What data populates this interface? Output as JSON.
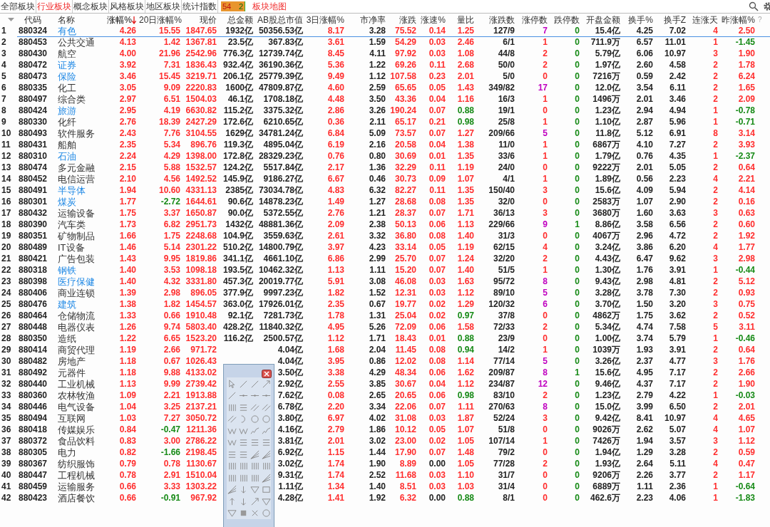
{
  "tabs": [
    {
      "label": "全部板块",
      "selected": false
    },
    {
      "label": "行业板块",
      "selected": true
    },
    {
      "label": "概念板块",
      "selected": false
    },
    {
      "label": "风格板块",
      "selected": false
    },
    {
      "label": "地区板块",
      "selected": false
    },
    {
      "label": "统计指数",
      "selected": false
    }
  ],
  "breadth": {
    "up": "54",
    "down": "2",
    "level": 0.96
  },
  "map_link": "板块地图",
  "header": {
    "help": "?",
    "columns": [
      {
        "label": "代码",
        "kind": "plain",
        "sorted": false
      },
      {
        "label": "名称",
        "kind": "plain",
        "sorted": false
      },
      {
        "label": "涨幅%",
        "kind": "gain",
        "sorted": true
      },
      {
        "label": "20日涨幅%",
        "kind": "gain",
        "sorted": false
      },
      {
        "label": "现价",
        "kind": "gain",
        "sorted": false
      },
      {
        "label": "总金额",
        "kind": "plain",
        "sorted": false
      },
      {
        "label": "AB股总市值",
        "kind": "plain",
        "sorted": false
      },
      {
        "label": "3日涨幅%",
        "kind": "gain",
        "sorted": false
      },
      {
        "label": "市净率",
        "kind": "plain",
        "sorted": false
      },
      {
        "label": "涨跌",
        "kind": "gain",
        "sorted": false
      },
      {
        "label": "涨速%",
        "kind": "gain",
        "sorted": false
      },
      {
        "label": "量比",
        "kind": "gain",
        "sorted": false
      },
      {
        "label": "涨跌数",
        "kind": "plain",
        "sorted": false
      },
      {
        "label": "涨停数",
        "kind": "gain",
        "sorted": false
      },
      {
        "label": "跌停数",
        "kind": "loss",
        "sorted": false
      },
      {
        "label": "开盘金额",
        "kind": "plain",
        "sorted": false
      },
      {
        "label": "换手%",
        "kind": "plain",
        "sorted": false
      },
      {
        "label": "换手Z",
        "kind": "plain",
        "sorted": false
      },
      {
        "label": "连涨天",
        "kind": "gain",
        "sorted": false
      },
      {
        "label": "昨涨幅%",
        "kind": "gain",
        "sorted": false
      }
    ]
  },
  "rows": [
    {
      "no": "1",
      "code": "880324",
      "name": "有色",
      "marked": true,
      "selected": true,
      "under_toolbar": false,
      "cells": [
        "4.26",
        "15.55",
        "1847.65",
        "1932亿",
        "50356.53亿",
        "8.17",
        "3.28",
        "75.52",
        "0.14",
        "1.25",
        "127/9",
        {
          "text": "7",
          "kind": "hot"
        },
        "0",
        "15.4亿",
        "4.25",
        "7.02",
        "4",
        "2.50"
      ]
    },
    {
      "no": "2",
      "code": "880453",
      "name": "公共交通",
      "marked": false,
      "selected": false,
      "under_toolbar": false,
      "cells": [
        "4.13",
        "1.42",
        "1367.81",
        "23.5亿",
        "367.83亿",
        "3.61",
        "1.59",
        "54.29",
        "0.03",
        "2.46",
        "6/1",
        "1",
        "0",
        "711.9万",
        "6.57",
        "11.01",
        "1",
        {
          "text": "-1.45",
          "kind": "loss"
        }
      ]
    },
    {
      "no": "3",
      "code": "880430",
      "name": "航空",
      "marked": false,
      "selected": false,
      "under_toolbar": false,
      "cells": [
        "4.00",
        "21.96",
        "2542.96",
        "776.3亿",
        "12739.74亿",
        "8.45",
        "4.11",
        "97.92",
        "0.03",
        "1.08",
        "44/8",
        "2",
        "0",
        "5.79亿",
        "6.06",
        "10.97",
        "3",
        "1.90"
      ]
    },
    {
      "no": "4",
      "code": "880472",
      "name": "证券",
      "marked": true,
      "selected": false,
      "under_toolbar": false,
      "cells": [
        "3.92",
        "7.31",
        "1836.43",
        "932.4亿",
        "36190.36亿",
        "5.36",
        "1.22",
        "69.26",
        "0.11",
        "2.68",
        "50/0",
        "2",
        "0",
        "1.97亿",
        "2.60",
        "4.58",
        "2",
        "1.78"
      ]
    },
    {
      "no": "5",
      "code": "880473",
      "name": "保险",
      "marked": true,
      "selected": false,
      "under_toolbar": false,
      "cells": [
        "3.46",
        "15.45",
        "3219.71",
        "206.1亿",
        "25779.39亿",
        "9.49",
        "1.12",
        "107.58",
        "0.23",
        "2.01",
        "5/0",
        "0",
        "0",
        "7216万",
        "0.59",
        "2.42",
        "2",
        "6.24"
      ]
    },
    {
      "no": "6",
      "code": "880335",
      "name": "化工",
      "marked": false,
      "selected": false,
      "under_toolbar": false,
      "cells": [
        "3.05",
        "9.09",
        "2220.83",
        "1600亿",
        "47809.87亿",
        "4.60",
        "2.59",
        "65.65",
        "0.05",
        "1.43",
        "349/82",
        {
          "text": "17",
          "kind": "hot"
        },
        "0",
        "12.0亿",
        "3.54",
        "6.11",
        "2",
        "1.65"
      ]
    },
    {
      "no": "7",
      "code": "880497",
      "name": "综合类",
      "marked": false,
      "selected": false,
      "under_toolbar": false,
      "cells": [
        "2.97",
        "6.51",
        "1504.03",
        "46.1亿",
        "1708.18亿",
        "4.48",
        "3.50",
        "43.36",
        "0.04",
        "1.16",
        "16/3",
        "1",
        "0",
        "1496万",
        "2.01",
        "3.46",
        "2",
        "2.09"
      ]
    },
    {
      "no": "8",
      "code": "880424",
      "name": "旅游",
      "marked": true,
      "selected": false,
      "under_toolbar": false,
      "cells": [
        "2.95",
        "4.19",
        "6630.82",
        "115.2亿",
        "3375.32亿",
        "2.86",
        "3.26",
        "190.24",
        "0.07",
        {
          "text": "0.88",
          "kind": "loss"
        },
        "19/1",
        "0",
        "0",
        "1.23亿",
        "2.94",
        "4.94",
        "1",
        {
          "text": "-0.78",
          "kind": "loss"
        }
      ]
    },
    {
      "no": "9",
      "code": "880330",
      "name": "化纤",
      "marked": false,
      "selected": false,
      "under_toolbar": false,
      "cells": [
        "2.76",
        "18.39",
        "2427.29",
        "172.6亿",
        "6210.65亿",
        "0.36",
        "2.11",
        "65.17",
        "0.21",
        {
          "text": "0.98",
          "kind": "loss"
        },
        "25/8",
        "1",
        "0",
        "1.10亿",
        "2.87",
        "5.96",
        "1",
        {
          "text": "-0.71",
          "kind": "loss"
        }
      ]
    },
    {
      "no": "10",
      "code": "880493",
      "name": "软件服务",
      "marked": false,
      "selected": false,
      "under_toolbar": false,
      "cells": [
        "2.43",
        "7.76",
        "3104.55",
        "1629亿",
        "34781.24亿",
        "6.84",
        "5.09",
        "73.57",
        "0.07",
        "1.27",
        "209/66",
        {
          "text": "5",
          "kind": "hot"
        },
        "0",
        "11.8亿",
        "5.12",
        "6.91",
        "8",
        "3.14"
      ]
    },
    {
      "no": "11",
      "code": "880431",
      "name": "船舶",
      "marked": false,
      "selected": false,
      "under_toolbar": false,
      "cells": [
        "2.35",
        "5.34",
        "896.76",
        "119.3亿",
        "4895.04亿",
        "6.19",
        "2.16",
        "20.58",
        "0.04",
        "1.38",
        "11/0",
        "1",
        "0",
        "6867万",
        "4.10",
        "7.27",
        "2",
        "3.93"
      ]
    },
    {
      "no": "12",
      "code": "880310",
      "name": "石油",
      "marked": true,
      "selected": false,
      "under_toolbar": false,
      "cells": [
        "2.24",
        "4.29",
        "1398.00",
        "172.8亿",
        "28329.23亿",
        "0.76",
        "0.80",
        "30.69",
        "0.01",
        "1.35",
        "33/6",
        "1",
        "0",
        "1.79亿",
        "0.76",
        "4.35",
        "1",
        {
          "text": "-2.37",
          "kind": "loss"
        }
      ]
    },
    {
      "no": "13",
      "code": "880474",
      "name": "多元金融",
      "marked": false,
      "selected": false,
      "under_toolbar": false,
      "cells": [
        "2.15",
        "5.88",
        "1532.57",
        "124.2亿",
        "5517.84亿",
        "2.17",
        "1.36",
        "32.29",
        "0.11",
        "1.19",
        "24/0",
        "0",
        "0",
        "9222万",
        "2.01",
        "5.05",
        "2",
        "0.64"
      ]
    },
    {
      "no": "14",
      "code": "880452",
      "name": "电信运营",
      "marked": false,
      "selected": false,
      "under_toolbar": false,
      "cells": [
        "2.10",
        "4.56",
        "1492.52",
        "145.9亿",
        "9186.27亿",
        "6.67",
        "0.46",
        "30.73",
        "0.09",
        "1.07",
        "4/1",
        "1",
        "0",
        "1.89亿",
        "0.56",
        "2.23",
        "4",
        "2.21"
      ]
    },
    {
      "no": "15",
      "code": "880491",
      "name": "半导体",
      "marked": true,
      "selected": false,
      "under_toolbar": false,
      "cells": [
        "1.94",
        "10.60",
        "4331.13",
        "2385亿",
        "73034.78亿",
        "4.83",
        "6.32",
        "82.27",
        "0.11",
        "1.35",
        "150/40",
        "3",
        "0",
        "15.6亿",
        "4.09",
        "5.94",
        "2",
        "4.14"
      ]
    },
    {
      "no": "16",
      "code": "880301",
      "name": "煤炭",
      "marked": true,
      "selected": false,
      "under_toolbar": false,
      "cells": [
        "1.77",
        {
          "text": "-2.72",
          "kind": "loss"
        },
        "1644.61",
        "90.6亿",
        "14878.23亿",
        "1.49",
        "1.27",
        "28.68",
        "0.08",
        "1.35",
        "32/0",
        "0",
        "0",
        "2583万",
        "1.07",
        "2.90",
        "2",
        "0.16"
      ]
    },
    {
      "no": "17",
      "code": "880432",
      "name": "运输设备",
      "marked": false,
      "selected": false,
      "under_toolbar": false,
      "cells": [
        "1.75",
        "3.37",
        "1650.87",
        "90.0亿",
        "5372.55亿",
        "2.76",
        "1.21",
        "28.37",
        "0.07",
        "1.71",
        "36/13",
        "3",
        "0",
        "3680万",
        "1.60",
        "3.63",
        "3",
        "0.63"
      ]
    },
    {
      "no": "18",
      "code": "880390",
      "name": "汽车类",
      "marked": false,
      "selected": false,
      "under_toolbar": false,
      "cells": [
        "1.73",
        "6.82",
        "2951.73",
        "1432亿",
        "48881.36亿",
        "2.09",
        "2.38",
        "50.13",
        "0.06",
        "1.13",
        "229/66",
        {
          "text": "9",
          "kind": "hot"
        },
        "1",
        "8.86亿",
        "3.58",
        "6.56",
        "2",
        "0.60"
      ]
    },
    {
      "no": "19",
      "code": "880351",
      "name": "矿物制品",
      "marked": false,
      "selected": false,
      "under_toolbar": false,
      "cells": [
        "1.66",
        "1.75",
        "2248.68",
        "104.9亿",
        "3559.63亿",
        "2.61",
        "3.32",
        "36.80",
        "0.08",
        "1.40",
        "31/3",
        "0",
        "0",
        "4067万",
        "2.96",
        "4.72",
        "2",
        "1.92"
      ]
    },
    {
      "no": "20",
      "code": "880489",
      "name": "IT设备",
      "marked": false,
      "selected": false,
      "under_toolbar": false,
      "cells": [
        "1.46",
        "5.14",
        "2301.22",
        "510.2亿",
        "14800.79亿",
        "3.97",
        "4.23",
        "33.14",
        "0.05",
        "1.19",
        "62/15",
        "4",
        "0",
        "3.24亿",
        "3.86",
        "6.20",
        "4",
        "1.77"
      ]
    },
    {
      "no": "21",
      "code": "880421",
      "name": "广告包装",
      "marked": false,
      "selected": false,
      "under_toolbar": false,
      "cells": [
        "1.43",
        "9.95",
        "1819.86",
        "341.1亿",
        "4661.10亿",
        "6.86",
        "2.99",
        "25.70",
        "0.07",
        "1.24",
        "32/20",
        "2",
        "0",
        "4.43亿",
        "6.47",
        "9.62",
        "3",
        "2.98"
      ]
    },
    {
      "no": "22",
      "code": "880318",
      "name": "钢铁",
      "marked": true,
      "selected": false,
      "under_toolbar": false,
      "cells": [
        "1.40",
        "3.53",
        "1098.18",
        "193.5亿",
        "10462.32亿",
        "1.13",
        "1.11",
        "15.20",
        "0.07",
        "1.40",
        "51/5",
        "1",
        "0",
        "1.30亿",
        "1.76",
        "3.91",
        "1",
        {
          "text": "-0.44",
          "kind": "loss"
        }
      ]
    },
    {
      "no": "23",
      "code": "880398",
      "name": "医疗保健",
      "marked": true,
      "selected": false,
      "under_toolbar": false,
      "cells": [
        "1.40",
        "4.32",
        "3331.80",
        "457.3亿",
        "20019.77亿",
        "5.91",
        "3.08",
        "46.08",
        "0.03",
        "1.63",
        "95/72",
        {
          "text": "8",
          "kind": "hot"
        },
        "0",
        "9.43亿",
        "2.98",
        "4.81",
        "2",
        "5.12"
      ]
    },
    {
      "no": "24",
      "code": "880406",
      "name": "商业连锁",
      "marked": false,
      "selected": false,
      "under_toolbar": false,
      "cells": [
        "1.39",
        "2.98",
        "896.05",
        "377.9亿",
        "9997.23亿",
        "1.82",
        "1.52",
        "12.31",
        "0.03",
        "1.12",
        "89/10",
        {
          "text": "5",
          "kind": "hot"
        },
        "0",
        "3.28亿",
        "3.78",
        "7.30",
        "2",
        "0.93"
      ]
    },
    {
      "no": "25",
      "code": "880476",
      "name": "建筑",
      "marked": true,
      "selected": false,
      "under_toolbar": false,
      "cells": [
        "1.38",
        "1.82",
        "1454.57",
        "363.0亿",
        "17926.01亿",
        "2.35",
        "0.67",
        "19.77",
        "0.02",
        "1.29",
        "120/32",
        {
          "text": "6",
          "kind": "hot"
        },
        "0",
        "3.70亿",
        "1.50",
        "3.20",
        "3",
        "0.75"
      ]
    },
    {
      "no": "26",
      "code": "880464",
      "name": "仓储物流",
      "marked": false,
      "selected": false,
      "under_toolbar": false,
      "cells": [
        "1.33",
        "0.66",
        "1910.48",
        "92.1亿",
        "7281.73亿",
        "1.78",
        "1.31",
        "25.04",
        "0.02",
        {
          "text": "0.97",
          "kind": "loss"
        },
        "37/8",
        "0",
        "0",
        "4862万",
        "1.75",
        "3.62",
        "2",
        "0.52"
      ]
    },
    {
      "no": "27",
      "code": "880448",
      "name": "电器仪表",
      "marked": false,
      "selected": false,
      "under_toolbar": false,
      "cells": [
        "1.26",
        "9.74",
        "5803.40",
        "428.2亿",
        "11840.32亿",
        "4.95",
        "5.26",
        "72.09",
        "0.06",
        "1.58",
        "72/33",
        "2",
        "0",
        "5.34亿",
        "4.74",
        "7.58",
        "5",
        "3.11"
      ]
    },
    {
      "no": "28",
      "code": "880350",
      "name": "造纸",
      "marked": false,
      "selected": false,
      "under_toolbar": false,
      "cells": [
        "1.22",
        "6.65",
        "1523.20",
        "116.2亿",
        "2500.57亿",
        "1.12",
        "1.71",
        "18.43",
        "0.01",
        {
          "text": "0.88",
          "kind": "loss"
        },
        "23/9",
        "0",
        "0",
        "1.00亿",
        "3.74",
        "5.79",
        "1",
        {
          "text": "-0.46",
          "kind": "loss"
        }
      ]
    },
    {
      "no": "29",
      "code": "880414",
      "name": "商贸代理",
      "marked": false,
      "selected": false,
      "under_toolbar": true,
      "cells": [
        "1.19",
        "2.66",
        "971.72",
        "4.04亿",
        "1.68",
        "2.04",
        "11.45",
        "0.08",
        {
          "text": "0.94",
          "kind": "loss"
        },
        "14/2",
        "1",
        "0",
        "1039万",
        "1.93",
        "3.91",
        "2",
        "0.64"
      ]
    },
    {
      "no": "30",
      "code": "880482",
      "name": "房地产",
      "marked": false,
      "selected": false,
      "under_toolbar": true,
      "cells": [
        "1.18",
        "0.67",
        "1026.43",
        "4.04亿",
        "3.95",
        "0.86",
        "12.02",
        "0.08",
        "1.14",
        "77/14",
        {
          "text": "5",
          "kind": "hot"
        },
        "0",
        "3.26亿",
        "2.37",
        "4.77",
        "3",
        "1.76"
      ]
    },
    {
      "no": "31",
      "code": "880492",
      "name": "元器件",
      "marked": false,
      "selected": false,
      "under_toolbar": true,
      "cells": [
        "1.18",
        "9.88",
        "4133.02",
        "3.50亿",
        "3.38",
        "4.29",
        "48.34",
        "0.06",
        "1.62",
        "209/87",
        {
          "text": "8",
          "kind": "hot"
        },
        "1",
        "15.6亿",
        "4.95",
        "7.17",
        "2",
        "2.66"
      ]
    },
    {
      "no": "32",
      "code": "880440",
      "name": "工业机械",
      "marked": false,
      "selected": false,
      "under_toolbar": true,
      "cells": [
        "1.13",
        "9.99",
        "2739.42",
        "2.92亿",
        "2.55",
        "3.85",
        "30.67",
        "0.04",
        "1.12",
        "234/87",
        {
          "text": "12",
          "kind": "hot"
        },
        "0",
        "9.46亿",
        "4.37",
        "7.17",
        "2",
        "1.90"
      ]
    },
    {
      "no": "33",
      "code": "880360",
      "name": "农林牧渔",
      "marked": false,
      "selected": false,
      "under_toolbar": true,
      "cells": [
        "1.09",
        "2.21",
        "1913.88",
        "7.62亿",
        "0.08",
        "2.65",
        "20.65",
        "0.06",
        {
          "text": "0.98",
          "kind": "loss"
        },
        "83/10",
        "2",
        "0",
        "1.23亿",
        "2.79",
        "4.22",
        "1",
        {
          "text": "-0.03",
          "kind": "loss"
        }
      ]
    },
    {
      "no": "34",
      "code": "880446",
      "name": "电气设备",
      "marked": false,
      "selected": false,
      "under_toolbar": true,
      "cells": [
        "1.04",
        "3.25",
        "2137.21",
        "6.78亿",
        "2.20",
        "3.34",
        "22.06",
        "0.07",
        "1.11",
        "270/63",
        {
          "text": "8",
          "kind": "hot"
        },
        "0",
        "15.0亿",
        "3.99",
        "6.50",
        "2",
        "2.01"
      ]
    },
    {
      "no": "35",
      "code": "880494",
      "name": "互联网",
      "marked": false,
      "selected": false,
      "under_toolbar": true,
      "cells": [
        "1.03",
        "7.27",
        "3050.72",
        "3.80亿",
        "6.97",
        "4.02",
        "31.08",
        "0.03",
        "1.87",
        "52/24",
        "3",
        "0",
        "9.42亿",
        "8.41",
        "10.97",
        "4",
        "4.65"
      ]
    },
    {
      "no": "36",
      "code": "880418",
      "name": "传媒娱乐",
      "marked": false,
      "selected": false,
      "under_toolbar": true,
      "cells": [
        "0.84",
        {
          "text": "-0.47",
          "kind": "loss"
        },
        "1211.36",
        "4.16亿",
        "2.79",
        "1.86",
        "10.12",
        "0.05",
        "1.07",
        "51/8",
        "0",
        "0",
        "9026万",
        "2.62",
        "5.07",
        "4",
        "1.07"
      ]
    },
    {
      "no": "37",
      "code": "880372",
      "name": "食品饮料",
      "marked": false,
      "selected": false,
      "under_toolbar": true,
      "cells": [
        "0.83",
        "3.00",
        "2786.22",
        "3.81亿",
        "2.01",
        "3.02",
        "23.00",
        "0.02",
        "1.05",
        "107/14",
        "1",
        "0",
        "7426万",
        "1.94",
        "3.57",
        "3",
        "1.12"
      ]
    },
    {
      "no": "38",
      "code": "880305",
      "name": "电力",
      "marked": false,
      "selected": false,
      "under_toolbar": true,
      "cells": [
        "0.82",
        {
          "text": "-1.66",
          "kind": "loss"
        },
        "2198.45",
        "6.92亿",
        "1.15",
        "1.44",
        "17.90",
        "0.07",
        "1.48",
        "79/2",
        "0",
        "0",
        "1.94亿",
        "1.29",
        "3.28",
        "2",
        "0.59"
      ]
    },
    {
      "no": "39",
      "code": "880367",
      "name": "纺织服饰",
      "marked": false,
      "selected": false,
      "under_toolbar": true,
      "cells": [
        "0.79",
        "0.78",
        "1130.67",
        "3.02亿",
        "1.74",
        "1.90",
        "8.89",
        {
          "text": "0.00",
          "kind": "flat"
        },
        "1.05",
        "77/28",
        "2",
        "0",
        "1.93亿",
        "2.64",
        "5.11",
        "4",
        "0.47"
      ]
    },
    {
      "no": "40",
      "code": "880447",
      "name": "工程机械",
      "marked": false,
      "selected": false,
      "under_toolbar": true,
      "cells": [
        "0.78",
        "2.91",
        "1510.04",
        "9.31亿",
        "1.74",
        "2.52",
        "11.68",
        "0.03",
        "1.10",
        "31/7",
        "0",
        "0",
        "9206万",
        "2.26",
        "3.77",
        "2",
        "1.17"
      ]
    },
    {
      "no": "41",
      "code": "880459",
      "name": "运输服务",
      "marked": false,
      "selected": false,
      "under_toolbar": true,
      "cells": [
        "0.66",
        "3.33",
        "1303.22",
        "1.11亿",
        "1.34",
        "1.40",
        "8.51",
        "0.03",
        "1.03",
        "31/4",
        "0",
        "0",
        "6889万",
        "1.11",
        "2.36",
        "1",
        {
          "text": "-0.64",
          "kind": "loss"
        }
      ]
    },
    {
      "no": "42",
      "code": "880423",
      "name": "酒店餐饮",
      "marked": false,
      "selected": false,
      "under_toolbar": true,
      "cells": [
        "0.66",
        {
          "text": "-0.91",
          "kind": "loss"
        },
        "967.92",
        "4.28亿",
        "1.41",
        "1.92",
        "6.32",
        {
          "text": "0.00",
          "kind": "flat"
        },
        {
          "text": "0.88",
          "kind": "loss"
        },
        "8/1",
        "0",
        "0",
        "462.6万",
        "2.23",
        "4.06",
        "1",
        {
          "text": "-1.83",
          "kind": "loss"
        }
      ]
    }
  ]
}
